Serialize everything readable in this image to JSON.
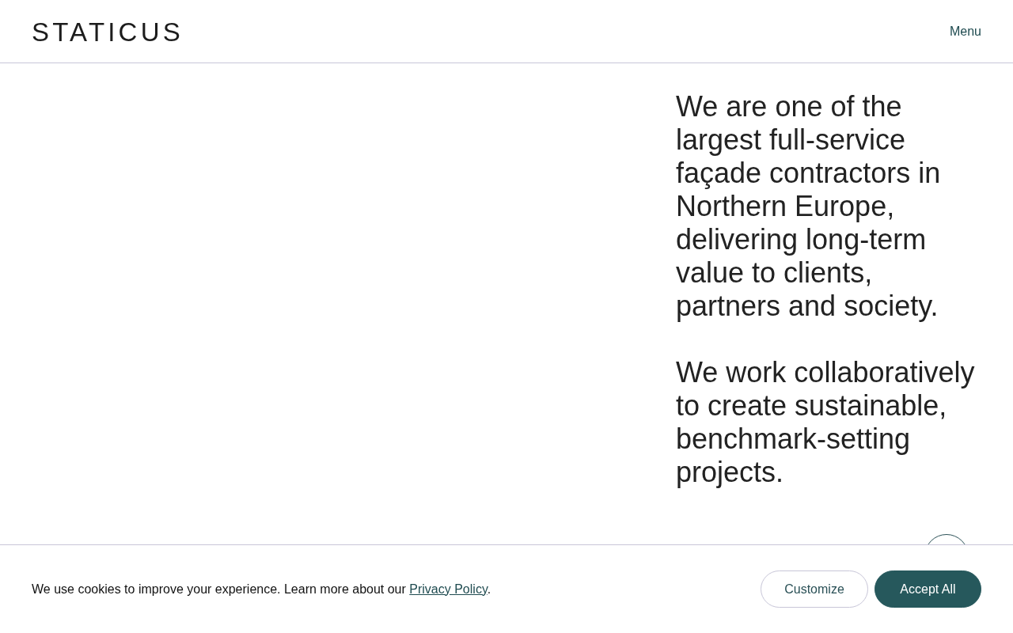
{
  "header": {
    "logo": "STATICUS",
    "menu": "Menu"
  },
  "intro": {
    "paragraphs": [
      "We are one of the largest full-service façade contractors in Northern Europe, delivering long-term value to clients, partners and society.",
      "We work collaboratively to create sustainable, benchmark-setting projects."
    ]
  },
  "cookie_banner": {
    "message": "We use cookies to improve your experience. Learn more about our",
    "link": "Privacy Policy",
    "message_end": ".",
    "buttons": [
      {
        "label": "Customize",
        "kind": "secondary"
      },
      {
        "label": "Accept All",
        "kind": "primary"
      }
    ]
  }
}
